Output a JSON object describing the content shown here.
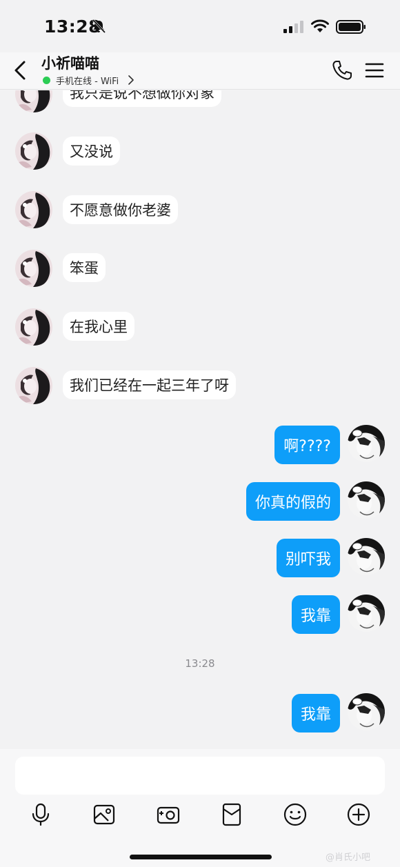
{
  "status_bar": {
    "time": "13:28"
  },
  "header": {
    "contact_name": "小祈喵喵",
    "online_status": "手机在线 - WiFi"
  },
  "conversation": {
    "incoming": [
      {
        "text": "我只是说不想做你对象"
      },
      {
        "text": "又没说"
      },
      {
        "text": "不愿意做你老婆"
      },
      {
        "text": "笨蛋"
      },
      {
        "text": "在我心里"
      },
      {
        "text": "我们已经在一起三年了呀"
      }
    ],
    "outgoing": [
      {
        "text": "啊????"
      },
      {
        "text": "你真的假的"
      },
      {
        "text": "别吓我"
      },
      {
        "text": "我靠"
      }
    ],
    "timestamp": "13:28",
    "last_outgoing": {
      "text": "我靠"
    }
  },
  "toolbar": {
    "icons": [
      "microphone-icon",
      "image-icon",
      "camera-icon",
      "red-packet-icon",
      "emoji-icon",
      "plus-icon"
    ]
  },
  "watermark": "@肖氏小吧",
  "colors": {
    "bubble_out": "#0e9ef9",
    "online": "#2ccd55",
    "background": "#f2f2f3"
  }
}
